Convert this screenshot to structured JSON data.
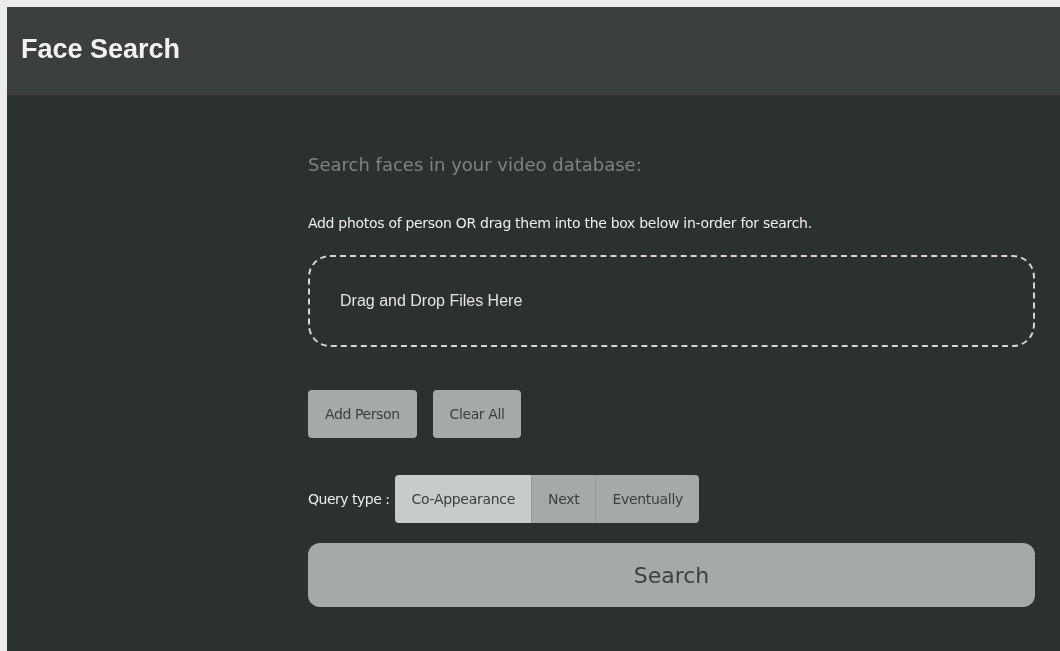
{
  "header": {
    "title": "Face Search"
  },
  "heading": "Search faces in your video database:",
  "instruction": "Add photos of person OR drag them into the box below in-order for search.",
  "dropzone": {
    "text": "Drag and Drop Files Here"
  },
  "buttons": [
    "Add Person",
    "Clear All"
  ],
  "query_type": {
    "label": "Query type :",
    "options": [
      {
        "label": "Co-Appearance",
        "selected": true
      },
      {
        "label": "Next",
        "selected": false
      },
      {
        "label": "Eventually",
        "selected": false
      }
    ]
  },
  "search_button": "Search"
}
